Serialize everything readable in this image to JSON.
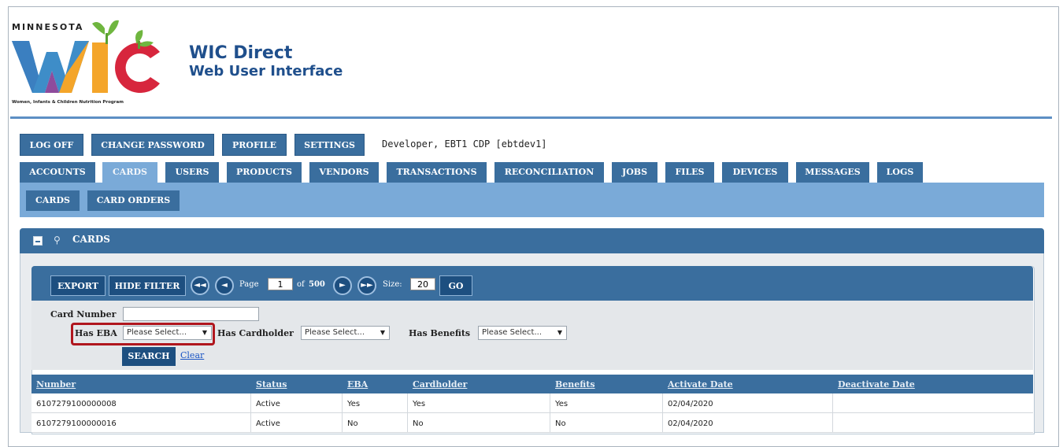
{
  "header": {
    "logo_state": "MINNESOTA",
    "logo_letters": "WIC",
    "logo_tagline": "Women, Infants & Children Nutrition Program",
    "title": "WIC Direct",
    "subtitle": "Web User Interface"
  },
  "account_bar": {
    "buttons": [
      "LOG OFF",
      "CHANGE PASSWORD",
      "PROFILE",
      "SETTINGS"
    ],
    "user_label": "Developer, EBT1 CDP [ebtdev1]"
  },
  "main_tabs": [
    "ACCOUNTS",
    "CARDS",
    "USERS",
    "PRODUCTS",
    "VENDORS",
    "TRANSACTIONS",
    "RECONCILIATION",
    "JOBS",
    "FILES",
    "DEVICES",
    "MESSAGES",
    "LOGS"
  ],
  "active_tab": "CARDS",
  "sub_tabs": [
    "CARDS",
    "CARD ORDERS"
  ],
  "panel": {
    "title": "CARDS"
  },
  "toolbar": {
    "export_label": "EXPORT",
    "hide_filter_label": "HIDE FILTER",
    "page_label": "Page",
    "page_value": "1",
    "of_label": "of",
    "total_pages": "500",
    "size_label": "Size:",
    "size_value": "20",
    "go_label": "GO"
  },
  "filters": {
    "card_number_label": "Card Number",
    "has_eba_label": "Has EBA",
    "has_eba_value": "Please Select...",
    "has_cardholder_label": "Has Cardholder",
    "has_cardholder_value": "Please Select...",
    "has_benefits_label": "Has Benefits",
    "has_benefits_value": "Please Select...",
    "search_label": "SEARCH",
    "clear_label": "Clear"
  },
  "table": {
    "columns": [
      "Number",
      "Status",
      "EBA",
      "Cardholder",
      "Benefits",
      "Activate Date",
      "Deactivate Date"
    ],
    "rows": [
      [
        "6107279100000008",
        "Active",
        "Yes",
        "Yes",
        "Yes",
        "02/04/2020",
        ""
      ],
      [
        "6107279100000016",
        "Active",
        "No",
        "No",
        "No",
        "02/04/2020",
        ""
      ]
    ]
  },
  "colors": {
    "primary": "#3a6e9e",
    "dark_button": "#1d4f80",
    "subnav": "#7aaad8",
    "highlight": "#b0161e"
  }
}
